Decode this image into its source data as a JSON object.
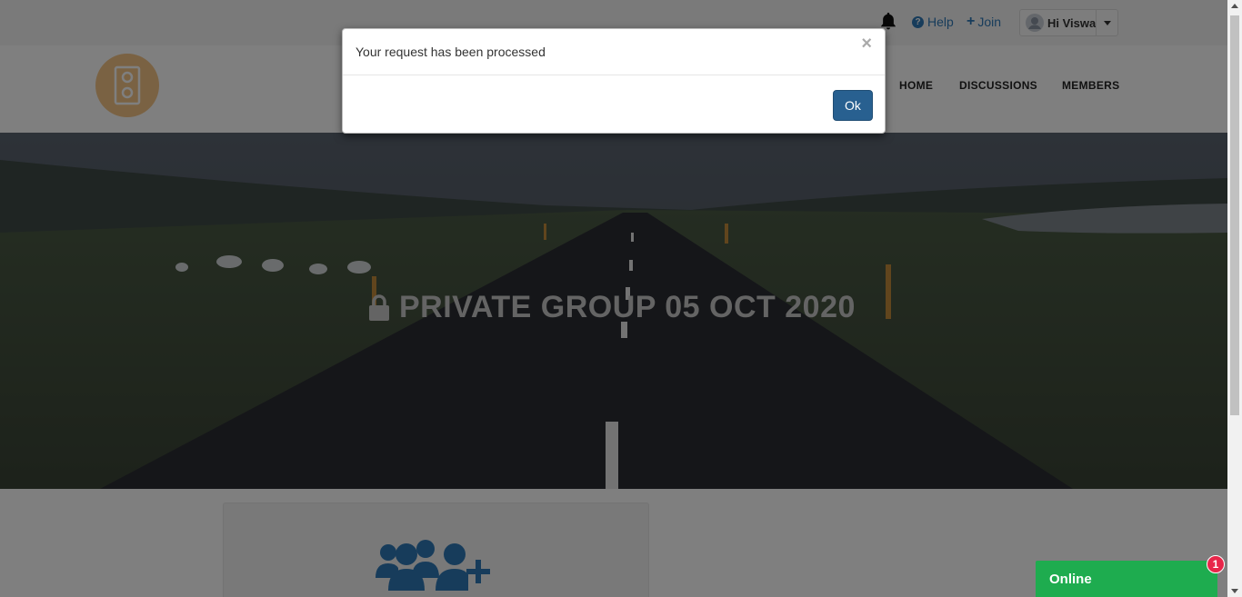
{
  "topbar": {
    "help_label": "Help",
    "join_label": "Join",
    "user_greeting": "Hi Viswa"
  },
  "nav": {
    "items": [
      "HOME",
      "DISCUSSIONS",
      "MEMBERS"
    ]
  },
  "hero": {
    "title": "PRIVATE GROUP 05 OCT 2020"
  },
  "modal": {
    "message": "Your request has been processed",
    "close_glyph": "×",
    "ok_label": "Ok"
  },
  "chat": {
    "status_label": "Online",
    "badge_count": "1"
  },
  "colors": {
    "link_blue": "#2e78b7",
    "primary_button": "#286090",
    "logo_orange": "#f5c487",
    "online_green": "#1eac4f",
    "badge_red": "#e8264a"
  },
  "icons": {
    "notifications": "bell-icon",
    "help": "question-circle-icon",
    "join": "plus-icon",
    "lock": "lock-icon",
    "group": "group-add-icon",
    "logo": "speaker-icon"
  }
}
